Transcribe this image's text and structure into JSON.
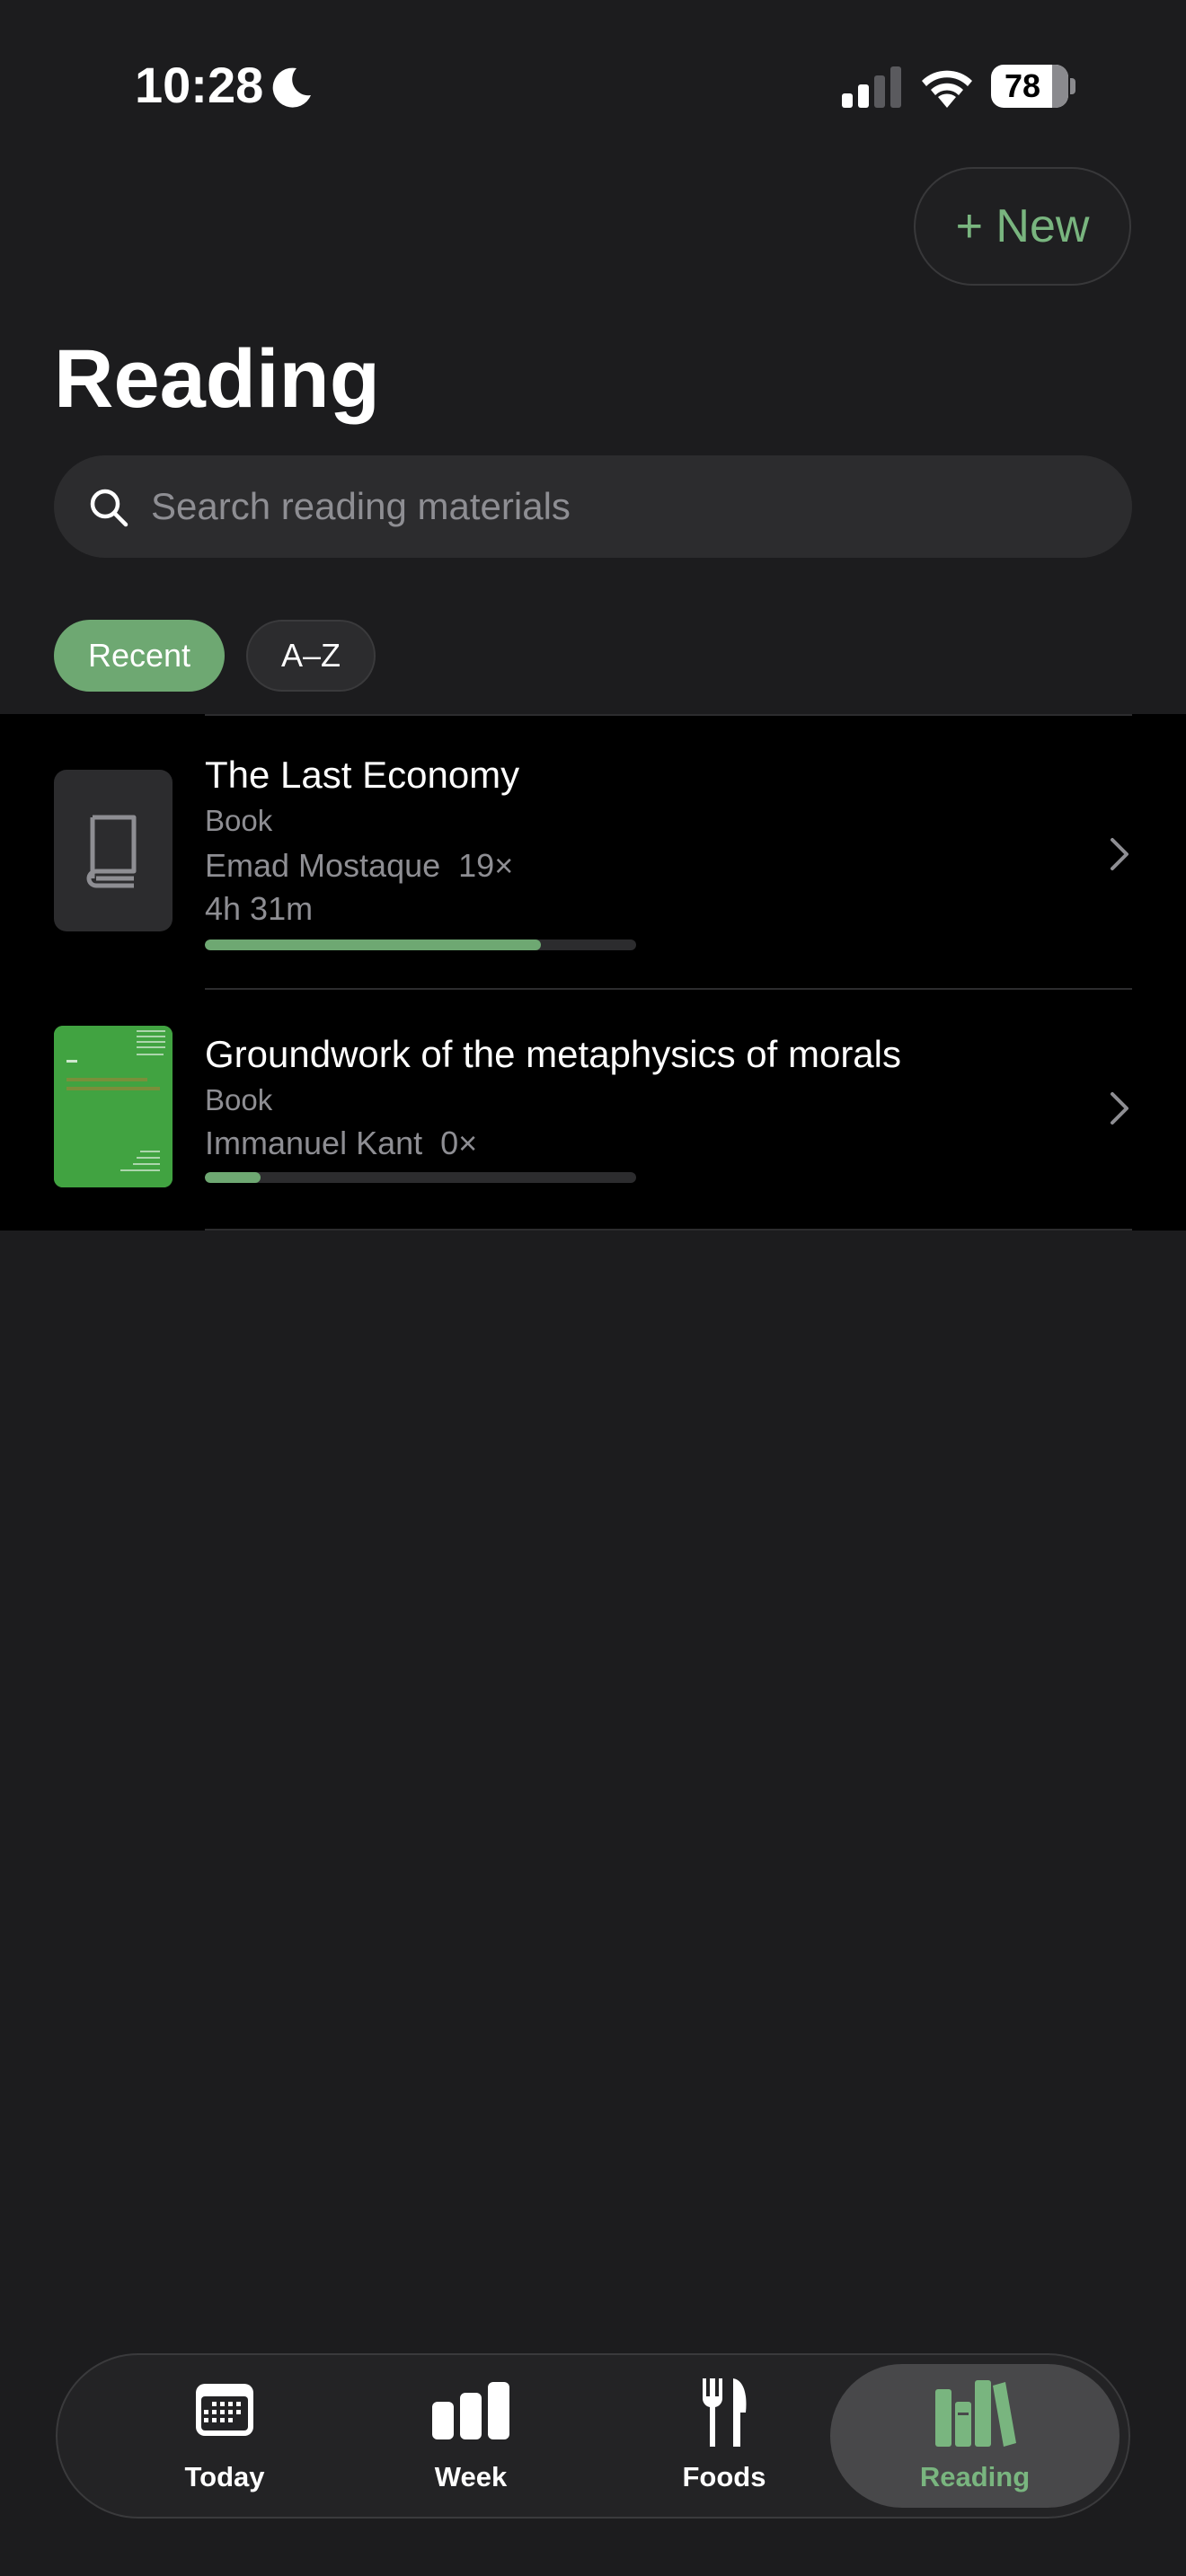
{
  "status_bar": {
    "time": "10:28",
    "battery": "78",
    "icons": [
      "moon-icon",
      "cellular-signal-icon",
      "wifi-icon",
      "battery-icon"
    ]
  },
  "header": {
    "new_button_label": "+ New",
    "title": "Reading"
  },
  "search": {
    "placeholder": "Search reading materials",
    "value": ""
  },
  "sort": {
    "options": [
      "Recent",
      "A–Z"
    ],
    "selected": "Recent"
  },
  "items": [
    {
      "title": "The Last Economy",
      "type": "Book",
      "meta": "Emad Mostaque  19×",
      "duration": "4h 31m",
      "progress": 0.78,
      "cover": "book-placeholder-icon"
    },
    {
      "title": "Groundwork of the metaphysics of morals",
      "type": "Book",
      "meta": "Immanuel Kant  0×",
      "progress": 0.13,
      "cover": "book-cover-image"
    }
  ],
  "tabs": [
    {
      "label": "Today",
      "icon": "calendar-icon"
    },
    {
      "label": "Week",
      "icon": "bar-chart-icon"
    },
    {
      "label": "Foods",
      "icon": "fork-knife-icon"
    },
    {
      "label": "Reading",
      "icon": "books-icon",
      "selected": true
    }
  ],
  "colors": {
    "background": "#1c1c1e",
    "accent": "#6ea872",
    "accent_text": "#79b57f",
    "list_background": "#000000",
    "secondary_text": "#8e8e93"
  }
}
